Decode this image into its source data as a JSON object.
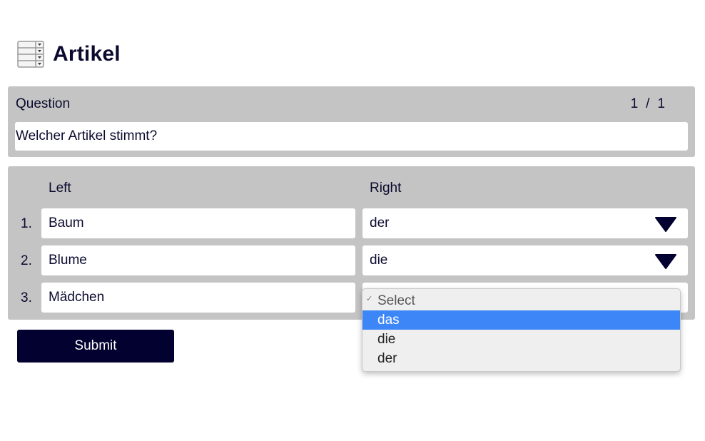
{
  "page": {
    "title": "Artikel",
    "title_icon": "table-select-icon"
  },
  "question": {
    "label": "Question",
    "current": "1",
    "separator": "/",
    "total": "1",
    "text": "Welcher Artikel stimmt?"
  },
  "matching": {
    "left_header": "Left",
    "right_header": "Right",
    "rows": [
      {
        "number": "1.",
        "left": "Baum",
        "right": "der"
      },
      {
        "number": "2.",
        "left": "Blume",
        "right": "die"
      },
      {
        "number": "3.",
        "left": "Mädchen",
        "right": ""
      }
    ]
  },
  "dropdown": {
    "options": [
      "Select",
      "das",
      "die",
      "der"
    ],
    "placeholder_check": "✓",
    "highlighted": "das"
  },
  "submit_label": "Submit",
  "colors": {
    "panel": "#c4c4c4",
    "text": "#0b0a2e",
    "button": "#02012f",
    "highlight": "#3d86f8"
  }
}
